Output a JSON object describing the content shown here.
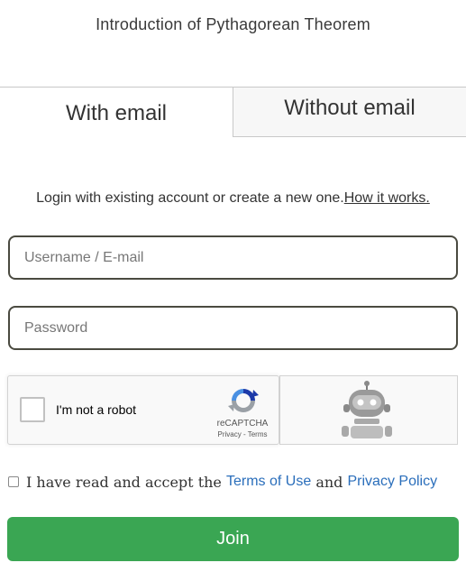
{
  "page": {
    "title": "Introduction of Pythagorean Theorem"
  },
  "tabs": [
    {
      "label": "With email",
      "active": true
    },
    {
      "label": "Without email",
      "active": false
    }
  ],
  "intro": {
    "text": "Login with existing account or create a new one.",
    "link": "How it works."
  },
  "form": {
    "username_placeholder": "Username / E-mail",
    "username_value": "",
    "password_placeholder": "Password",
    "password_value": ""
  },
  "recaptcha": {
    "label": "I'm not a robot",
    "brand": "reCAPTCHA",
    "links": "Privacy - Terms",
    "checked": false,
    "icon": "recaptcha-logo-icon"
  },
  "robot_panel": {
    "icon": "robot-icon"
  },
  "terms": {
    "checked": false,
    "prefix": "I have read and accept the ",
    "terms_link": "Terms of Use",
    "joiner": " and ",
    "privacy_link": "Privacy Policy"
  },
  "join_button": {
    "label": "Join"
  },
  "colors": {
    "join_green": "#3aa653",
    "link_blue": "#2a6ebb",
    "field_border": "#4a4a40"
  }
}
